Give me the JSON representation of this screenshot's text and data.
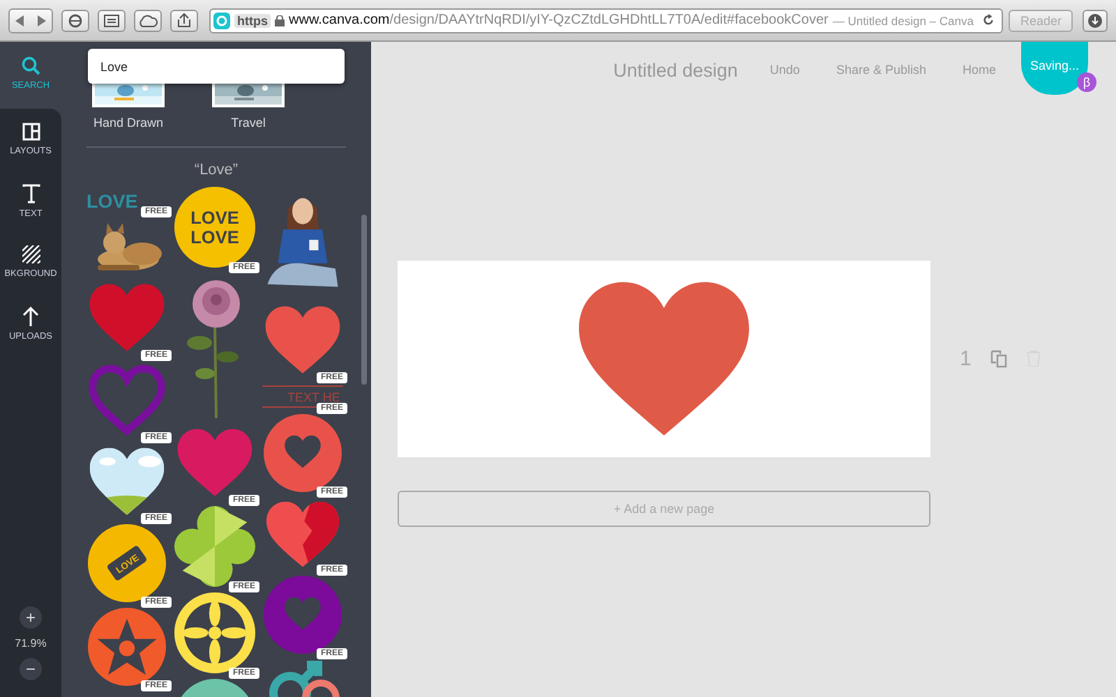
{
  "browser": {
    "scheme": "https",
    "host": "www.canva.com",
    "path": "/design/DAAYtrNqRDI/yIY-QzCZtdLGHDhtLL7T0A/edit#facebookCover",
    "page_title": "— Untitled design – Canva",
    "reader": "Reader"
  },
  "nav": {
    "items": [
      {
        "kind": "search",
        "label": "SEARCH",
        "selected": true
      },
      {
        "kind": "layouts",
        "label": "LAYOUTS",
        "selected": false
      },
      {
        "kind": "text",
        "label": "TEXT",
        "selected": false
      },
      {
        "kind": "background",
        "label": "BKGROUND",
        "selected": false
      },
      {
        "kind": "uploads",
        "label": "UPLOADS",
        "selected": false
      }
    ]
  },
  "zoom": {
    "plus": "+",
    "level": "71.9%",
    "minus": "−"
  },
  "panel": {
    "search": {
      "value": "Love"
    },
    "categories": [
      {
        "label": "Hand Drawn"
      },
      {
        "label": "Travel"
      }
    ],
    "results_title": "“Love”",
    "columns": [
      [
        {
          "kind": "wordmark",
          "text": "LOVE",
          "color": "#2e8fa0",
          "badge": "FREE"
        },
        {
          "kind": "picture"
        },
        {
          "kind": "heart",
          "color": "#d0102a",
          "badge": "FREE"
        },
        {
          "kind": "heart-outline",
          "color": "#7a0f9e",
          "badge": "FREE"
        },
        {
          "kind": "sky-heart",
          "color": "#cfeaf7",
          "badge": "FREE"
        },
        {
          "kind": "candy",
          "text": "LOVE",
          "color": "#f5b800",
          "badge": "FREE"
        },
        {
          "kind": "star",
          "color": "#f15a2b",
          "badge": "FREE"
        }
      ],
      [
        {
          "kind": "sticker",
          "lines": [
            "LOVE",
            "LOVE"
          ],
          "color": "#f5c000",
          "badge": "FREE"
        },
        {
          "kind": "picture"
        },
        {
          "kind": "heart",
          "color": "#d81b60",
          "badge": "FREE"
        },
        {
          "kind": "clover",
          "color": "#9cc93a",
          "badge": "FREE"
        },
        {
          "kind": "flower",
          "color": "#fbe04a",
          "badge": "FREE"
        },
        {
          "kind": "partial-circle",
          "color": "#6cc3a8"
        }
      ],
      [
        {
          "kind": "picture"
        },
        {
          "kind": "heart",
          "color": "#e8524a",
          "badge": "FREE"
        },
        {
          "kind": "banner",
          "text": "TEXT HE",
          "color": "#a8433e",
          "badge": "FREE"
        },
        {
          "kind": "circle-heart",
          "color": "#e8524a",
          "badge": "FREE"
        },
        {
          "kind": "broken-heart",
          "color": "#f04e4e",
          "badge": "FREE"
        },
        {
          "kind": "circle-heart",
          "color": "#7c0a9a",
          "badge": "FREE"
        },
        {
          "kind": "symbols",
          "color": "#3aa8a8"
        }
      ]
    ]
  },
  "header": {
    "title": "Untitled design",
    "actions": [
      "Undo",
      "Share & Publish",
      "Home"
    ],
    "status": "Saving...",
    "badge": "β"
  },
  "page": {
    "number": "1",
    "graphic": {
      "kind": "heart",
      "color": "#e05a48"
    }
  },
  "add_page": "+ Add a new page"
}
